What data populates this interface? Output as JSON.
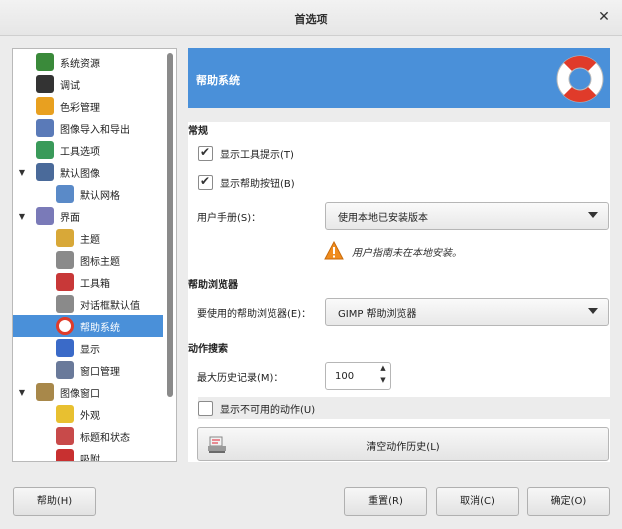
{
  "window": {
    "title": "首选项"
  },
  "sidebar": {
    "items": [
      {
        "label": "系统资源",
        "icon": "system-resources-icon",
        "level": 0,
        "expander": ""
      },
      {
        "label": "调试",
        "icon": "debugging-icon",
        "level": 0,
        "expander": ""
      },
      {
        "label": "色彩管理",
        "icon": "color-management-icon",
        "level": 0,
        "expander": ""
      },
      {
        "label": "图像导入和导出",
        "icon": "image-import-export-icon",
        "level": 0,
        "expander": ""
      },
      {
        "label": "工具选项",
        "icon": "tool-options-icon",
        "level": 0,
        "expander": ""
      },
      {
        "label": "默认图像",
        "icon": "default-image-icon",
        "level": 0,
        "expander": "expanded"
      },
      {
        "label": "默认网格",
        "icon": "default-grid-icon",
        "level": 1,
        "expander": ""
      },
      {
        "label": "界面",
        "icon": "interface-icon",
        "level": 0,
        "expander": "expanded"
      },
      {
        "label": "主题",
        "icon": "theme-icon",
        "level": 1,
        "expander": ""
      },
      {
        "label": "图标主题",
        "icon": "icon-theme-icon",
        "level": 1,
        "expander": ""
      },
      {
        "label": "工具箱",
        "icon": "toolbox-icon",
        "level": 1,
        "expander": ""
      },
      {
        "label": "对话框默认值",
        "icon": "dialog-defaults-icon",
        "level": 1,
        "expander": ""
      },
      {
        "label": "帮助系统",
        "icon": "help-system-icon",
        "level": 1,
        "expander": "",
        "selected": true
      },
      {
        "label": "显示",
        "icon": "display-icon",
        "level": 1,
        "expander": ""
      },
      {
        "label": "窗口管理",
        "icon": "window-management-icon",
        "level": 1,
        "expander": ""
      },
      {
        "label": "图像窗口",
        "icon": "image-windows-icon",
        "level": 0,
        "expander": "expanded"
      },
      {
        "label": "外观",
        "icon": "appearance-icon",
        "level": 1,
        "expander": ""
      },
      {
        "label": "标题和状态",
        "icon": "title-status-icon",
        "level": 1,
        "expander": ""
      },
      {
        "label": "吸附",
        "icon": "snapping-icon",
        "level": 1,
        "expander": ""
      }
    ]
  },
  "header": {
    "title": "帮助系统",
    "icon": "lifebuoy-icon"
  },
  "general": {
    "title": "常规",
    "show_tooltips": {
      "label": "显示工具提示(T)",
      "checked": true
    },
    "show_help_buttons": {
      "label": "显示帮助按钮(B)",
      "checked": true
    },
    "user_manual_label": "用户手册(S)：",
    "user_manual_value": "使用本地已安装版本",
    "warning_text": "用户指南未在本地安装。",
    "warning_icon": "warning-icon"
  },
  "help_browser": {
    "title": "帮助浏览器",
    "browser_label": "要使用的帮助浏览器(E)：",
    "browser_value": "GIMP 帮助浏览器"
  },
  "action_search": {
    "title": "动作搜索",
    "max_history_label": "最大历史记录(M)：",
    "max_history_value": "100",
    "show_unavailable": {
      "label": "显示不可用的动作(U)",
      "checked": false
    },
    "clear_history_label": "清空动作历史(L)",
    "clear_history_icon": "clear-history-icon"
  },
  "footer": {
    "help": "帮助(H)",
    "reset": "重置(R)",
    "cancel": "取消(C)",
    "ok": "确定(O)"
  },
  "colors": {
    "accent": "#4a90d9",
    "warning": "#f08c1e",
    "lifebuoy_red": "#e03b2a"
  }
}
